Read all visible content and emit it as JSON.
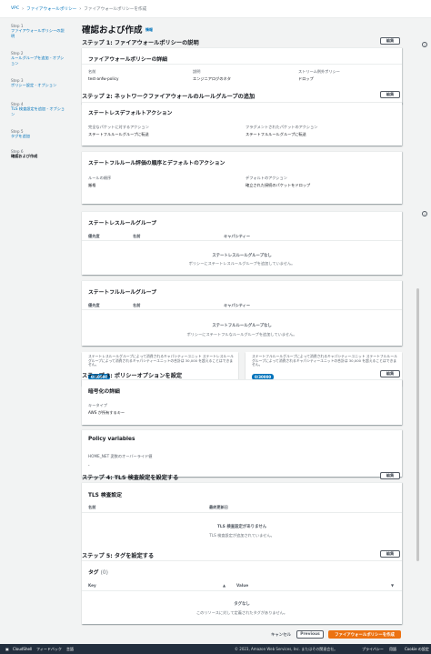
{
  "breadcrumb": {
    "vpc": "VPC",
    "separator": "›",
    "policies": "ファイアウォールポリシー",
    "current": "ファイアウォールポリシーを作成"
  },
  "steps": [
    {
      "num": "Step 1",
      "label": "ファイアウォールポリシーの説明"
    },
    {
      "num": "Step 2",
      "label": "ルールグループを追加 - オプション"
    },
    {
      "num": "Step 3",
      "label": "ポリシー設定 - オプション"
    },
    {
      "num": "Step 4",
      "label": "TLS 検査設定を追加 - オプション"
    },
    {
      "num": "Step 5",
      "label": "タグを追加"
    },
    {
      "num": "Step 6",
      "label": "確認および作成"
    }
  ],
  "page": {
    "title": "確認および作成",
    "info": "情報",
    "edit": "編集"
  },
  "s1": {
    "header": "ステップ 1: ファイアウォールポリシーの説明",
    "card_title": "ファイアウォールポリシーの詳細",
    "name_label": "名前",
    "name_value": "test-anfw-policy",
    "desc_label": "説明",
    "desc_value": "エンジニアログのネタ",
    "stream_label": "ストリーム例外ポリシー",
    "stream_value": "ドロップ"
  },
  "s2": {
    "header": "ステップ 2: ネットワークファイアウォールのルールグループの追加",
    "stateless_default_title": "ステートレスデフォルトアクション",
    "full_packets_label": "完全なパケットに対するアクション",
    "full_packets_value": "ステートフルルールグループに転送",
    "frag_label": "フラグメントされたパケットのアクション",
    "frag_value": "ステートフルルールグループに転送",
    "stateful_eval_title": "ステートフルルール評価の順序とデフォルトのアクション",
    "rule_order_label": "ルールの順序",
    "rule_order_value": "厳格",
    "default_action_label": "デフォルトのアクション",
    "default_action_value": "確立された接続のパケットをドロップ",
    "stateless_groups_title": "ステートレスルールグループ",
    "col_priority": "優先度",
    "col_name": "名前",
    "col_capacity": "キャパシティー",
    "stateless_empty_title": "ステートレスルールグループなし",
    "stateless_empty_sub": "ポリシーにステートレスルールグループを追加していません。",
    "stateful_groups_title": "ステートフルルールグループ",
    "stateful_empty_title": "ステートフルルールグループなし",
    "stateful_empty_sub": "ポリシーにステートフルなルールグループを追加していません。",
    "cap_stateless_desc": "ステートレスルールグループによって消費されるキャパシティーユニット ステートレスルールグループによって消費されるキャパシティーユニットの合計は 30,000 を超えることはできません。",
    "cap_stateless_value": "0/30000",
    "cap_stateful_desc": "ステートフルルールグループによって消費されるキャパシティーユニット ステートフルルールグループによって消費されるキャパシティーユニットの合計は 30,000 を超えることはできません。",
    "cap_stateful_value": "0/30000"
  },
  "s3": {
    "header": "ステップ 3: ポリシーオプションを設定",
    "enc_title": "暗号化の詳細",
    "key_type_label": "キータイプ",
    "key_type_value": "AWS が所有するキー",
    "vars_title": "Policy variables",
    "home_net_label": "HOME_NET 変数のオーバーライド値",
    "home_net_value": "-"
  },
  "s4": {
    "header": "ステップ 4: TLS 検査設定を設定する",
    "tls_title": "TLS 検査設定",
    "col_name": "名前",
    "col_updated": "最終更新日",
    "empty_title": "TLS 検査設定がありません",
    "empty_sub": "TLS 検査設定が追加されていません。"
  },
  "s5": {
    "header": "ステップ 5: タグを設定する",
    "tags_title": "タグ",
    "tags_count": "(0)",
    "col_key": "Key",
    "col_value": "Value",
    "empty_title": "タグなし",
    "empty_sub": "このリソースに対して定義されたタグがありません。"
  },
  "footer": {
    "cancel": "キャンセル",
    "previous": "Previous",
    "create": "ファイアウォールポリシーを作成"
  },
  "bottom": {
    "cloudshell": "CloudShell",
    "feedback": "フィードバック",
    "language": "言語",
    "copyright": "© 2023, Amazon Web Services, Inc. またはその関連会社。",
    "privacy": "プライバシー",
    "terms": "用語",
    "cookie": "Cookie の設定"
  },
  "colors": {
    "accent": "#0073bb",
    "primary_button": "#ec7211",
    "bottom_bar": "#232f3e"
  }
}
